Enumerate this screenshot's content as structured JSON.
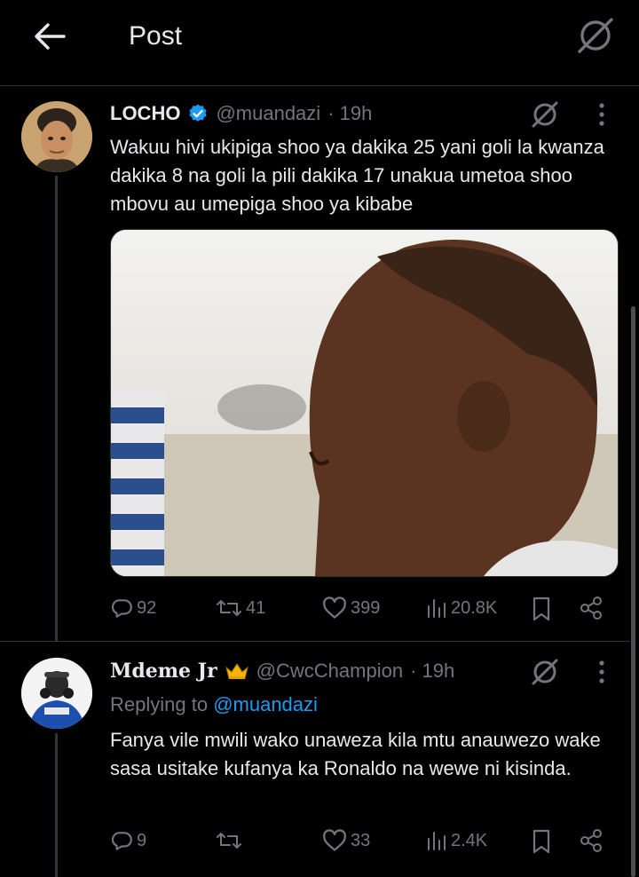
{
  "header": {
    "title": "Post"
  },
  "tweet": {
    "name": "LOCHO",
    "handle": "@muandazi",
    "time": "· 19h",
    "text": "Wakuu hivi ukipiga shoo ya dakika 25 yani goli la kwanza dakika 8 na goli la pili dakika 17 unakua umetoa shoo mbovu au umepiga shoo ya kibabe",
    "stats": {
      "replies": "92",
      "reposts": "41",
      "likes": "399",
      "views": "20.8K"
    }
  },
  "reply": {
    "name": "Mdeme Jr",
    "handle": "@CwcChampion",
    "time": "· 19h",
    "replying_prefix": "Replying to ",
    "replying_to": "@muandazi",
    "text": "Fanya vile mwili wako unaweza kila mtu anauwezo wake sasa usitake kufanya ka Ronaldo na wewe ni kisinda.",
    "stats": {
      "replies": "9",
      "reposts": "",
      "likes": "33",
      "views": "2.4K"
    }
  },
  "colors": {
    "accent": "#1d9bf0",
    "muted": "#71767b",
    "verified": "#1d9bf0",
    "crown": "#f4b400"
  },
  "icons": [
    "back-arrow-icon",
    "grok-icon",
    "verified-badge-icon",
    "more-icon",
    "reply-icon",
    "repost-icon",
    "like-icon",
    "views-icon",
    "bookmark-icon",
    "share-icon",
    "crown-icon"
  ]
}
